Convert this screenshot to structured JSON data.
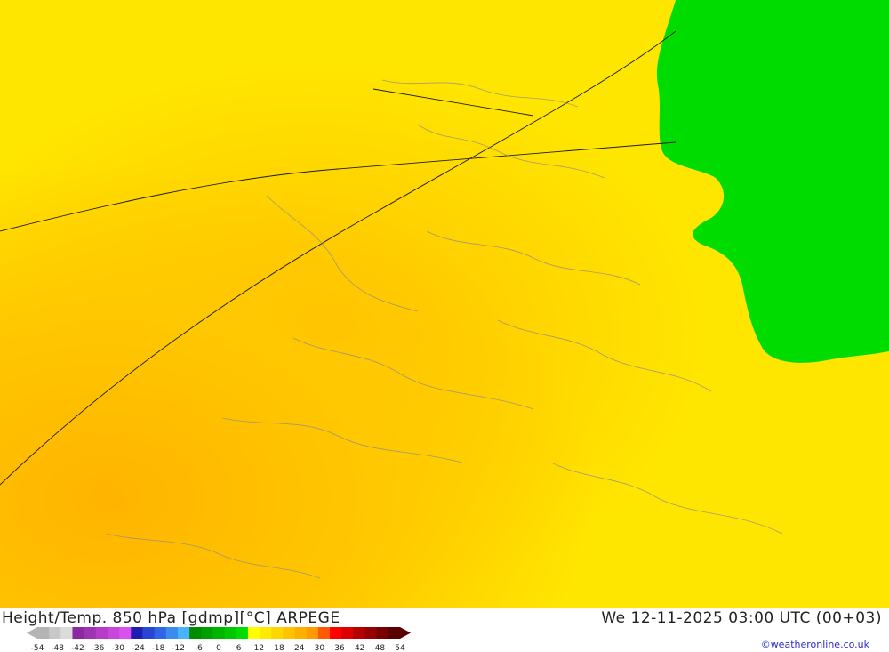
{
  "header": {
    "title": "Height/Temp. 850 hPa [gdmp][°C] ARPEGE",
    "valid_time": "We 12-11-2025 03:00 UTC (00+03)"
  },
  "credit": "©weatheronline.co.uk",
  "legend": {
    "ticks": [
      "-54",
      "-48",
      "-42",
      "-36",
      "-30",
      "-24",
      "-18",
      "-12",
      "-6",
      "0",
      "6",
      "12",
      "18",
      "24",
      "30",
      "36",
      "42",
      "48",
      "54"
    ],
    "colors": [
      "#b4b4b4",
      "#c8c8c8",
      "#dcdcdc",
      "#8c28a0",
      "#a032b4",
      "#b43cc8",
      "#c846dc",
      "#dc50f0",
      "#1e1eb4",
      "#2846d2",
      "#3264e6",
      "#3c8cf0",
      "#46b4ff",
      "#008c00",
      "#00a000",
      "#00b400",
      "#00c800",
      "#00dc00",
      "#ffff00",
      "#ffeb00",
      "#ffd700",
      "#ffc300",
      "#ffaf00",
      "#ff9b00",
      "#ff5a00",
      "#ff0000",
      "#dc0000",
      "#b40000",
      "#960000",
      "#780000",
      "#5a0000"
    ]
  },
  "map": {
    "colors": {
      "warm_fill": "#ffe000",
      "warm_fill_dark": "#ffc800",
      "cold_fill": "#00dc00",
      "contour_line": "#1e1e1e",
      "border_line": "#8c8c8c"
    }
  }
}
